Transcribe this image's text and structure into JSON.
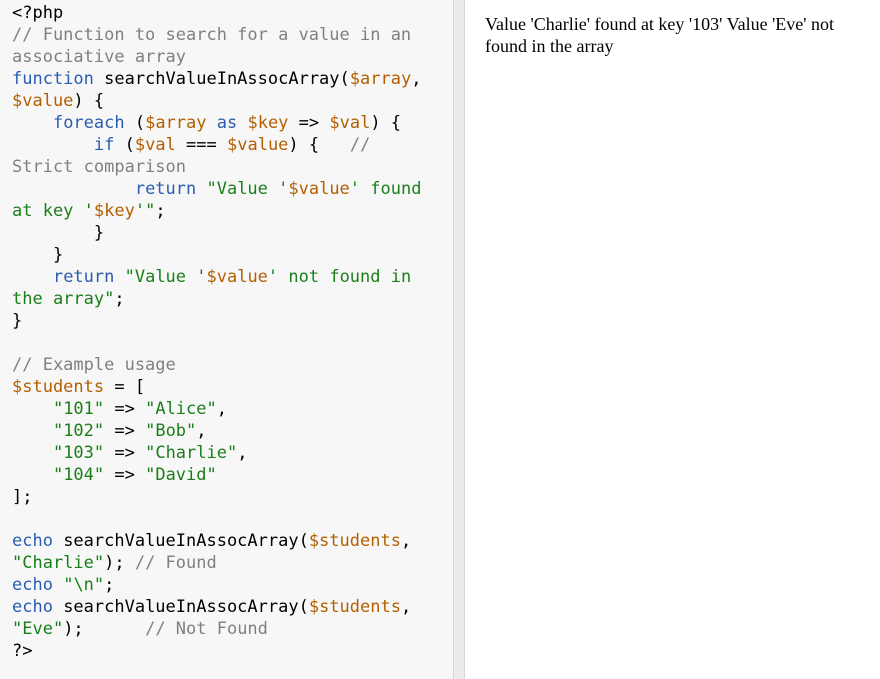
{
  "code": {
    "lines": [
      [
        {
          "t": "<?php",
          "c": "tag"
        }
      ],
      [
        {
          "t": "// Function to search for a value in an",
          "c": "comment"
        }
      ],
      [
        {
          "t": "associative array",
          "c": "comment"
        }
      ],
      [
        {
          "t": "function",
          "c": "kw"
        },
        {
          "t": " searchValueInAssocArray(",
          "c": "plain"
        },
        {
          "t": "$array",
          "c": "var"
        },
        {
          "t": ",",
          "c": "punc"
        }
      ],
      [
        {
          "t": "$value",
          "c": "var"
        },
        {
          "t": ") {",
          "c": "punc"
        }
      ],
      [
        {
          "t": "    ",
          "c": "plain"
        },
        {
          "t": "foreach",
          "c": "kw"
        },
        {
          "t": " (",
          "c": "punc"
        },
        {
          "t": "$array",
          "c": "var"
        },
        {
          "t": " as ",
          "c": "kw"
        },
        {
          "t": "$key",
          "c": "var"
        },
        {
          "t": " => ",
          "c": "punc"
        },
        {
          "t": "$val",
          "c": "var"
        },
        {
          "t": ") {",
          "c": "punc"
        }
      ],
      [
        {
          "t": "        ",
          "c": "plain"
        },
        {
          "t": "if",
          "c": "kw"
        },
        {
          "t": " (",
          "c": "punc"
        },
        {
          "t": "$val",
          "c": "var"
        },
        {
          "t": " === ",
          "c": "punc"
        },
        {
          "t": "$value",
          "c": "var"
        },
        {
          "t": ") {   ",
          "c": "punc"
        },
        {
          "t": "//",
          "c": "comment"
        }
      ],
      [
        {
          "t": "Strict comparison",
          "c": "comment"
        }
      ],
      [
        {
          "t": "            ",
          "c": "plain"
        },
        {
          "t": "return",
          "c": "kw"
        },
        {
          "t": " \"Value '",
          "c": "str"
        },
        {
          "t": "$value",
          "c": "var"
        },
        {
          "t": "' found",
          "c": "str"
        }
      ],
      [
        {
          "t": "at key '",
          "c": "str"
        },
        {
          "t": "$key",
          "c": "var"
        },
        {
          "t": "'\"",
          "c": "str"
        },
        {
          "t": ";",
          "c": "punc"
        }
      ],
      [
        {
          "t": "        }",
          "c": "punc"
        }
      ],
      [
        {
          "t": "    }",
          "c": "punc"
        }
      ],
      [
        {
          "t": "    ",
          "c": "plain"
        },
        {
          "t": "return",
          "c": "kw"
        },
        {
          "t": " \"Value '",
          "c": "str"
        },
        {
          "t": "$value",
          "c": "var"
        },
        {
          "t": "' not found in",
          "c": "str"
        }
      ],
      [
        {
          "t": "the array\"",
          "c": "str"
        },
        {
          "t": ";",
          "c": "punc"
        }
      ],
      [
        {
          "t": "}",
          "c": "punc"
        }
      ],
      [
        {
          "t": "",
          "c": "plain"
        }
      ],
      [
        {
          "t": "// Example usage",
          "c": "comment"
        }
      ],
      [
        {
          "t": "$students",
          "c": "var"
        },
        {
          "t": " = [",
          "c": "punc"
        }
      ],
      [
        {
          "t": "    ",
          "c": "plain"
        },
        {
          "t": "\"101\"",
          "c": "str"
        },
        {
          "t": " => ",
          "c": "punc"
        },
        {
          "t": "\"Alice\"",
          "c": "str"
        },
        {
          "t": ",",
          "c": "punc"
        }
      ],
      [
        {
          "t": "    ",
          "c": "plain"
        },
        {
          "t": "\"102\"",
          "c": "str"
        },
        {
          "t": " => ",
          "c": "punc"
        },
        {
          "t": "\"Bob\"",
          "c": "str"
        },
        {
          "t": ",",
          "c": "punc"
        }
      ],
      [
        {
          "t": "    ",
          "c": "plain"
        },
        {
          "t": "\"103\"",
          "c": "str"
        },
        {
          "t": " => ",
          "c": "punc"
        },
        {
          "t": "\"Charlie\"",
          "c": "str"
        },
        {
          "t": ",",
          "c": "punc"
        }
      ],
      [
        {
          "t": "    ",
          "c": "plain"
        },
        {
          "t": "\"104\"",
          "c": "str"
        },
        {
          "t": " => ",
          "c": "punc"
        },
        {
          "t": "\"David\"",
          "c": "str"
        }
      ],
      [
        {
          "t": "];",
          "c": "punc"
        }
      ],
      [
        {
          "t": "",
          "c": "plain"
        }
      ],
      [
        {
          "t": "echo",
          "c": "kw"
        },
        {
          "t": " searchValueInAssocArray(",
          "c": "plain"
        },
        {
          "t": "$students",
          "c": "var"
        },
        {
          "t": ",",
          "c": "punc"
        }
      ],
      [
        {
          "t": "\"Charlie\"",
          "c": "str"
        },
        {
          "t": "); ",
          "c": "punc"
        },
        {
          "t": "// Found",
          "c": "comment"
        }
      ],
      [
        {
          "t": "echo",
          "c": "kw"
        },
        {
          "t": " ",
          "c": "plain"
        },
        {
          "t": "\"\\n\"",
          "c": "str"
        },
        {
          "t": ";",
          "c": "punc"
        }
      ],
      [
        {
          "t": "echo",
          "c": "kw"
        },
        {
          "t": " searchValueInAssocArray(",
          "c": "plain"
        },
        {
          "t": "$students",
          "c": "var"
        },
        {
          "t": ",",
          "c": "punc"
        }
      ],
      [
        {
          "t": "\"Eve\"",
          "c": "str"
        },
        {
          "t": ");      ",
          "c": "punc"
        },
        {
          "t": "// Not Found",
          "c": "comment"
        }
      ],
      [
        {
          "t": "?>",
          "c": "tag"
        }
      ]
    ]
  },
  "output": {
    "text": "Value 'Charlie' found at key '103' Value 'Eve' not found in the array"
  },
  "colors": {
    "code_background": "#f7f7f7",
    "keyword": "#2a5db0",
    "variable": "#b35f00",
    "string": "#1a7f1a",
    "comment": "#808080"
  }
}
